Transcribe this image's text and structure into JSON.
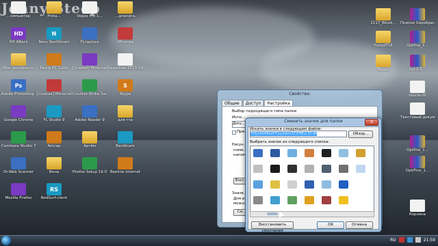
{
  "watermark": "Jonny Steep",
  "colors": {
    "folder": "#e5b53e",
    "taskbar": "#2a3543",
    "dialog_frame": "#a9c8e3"
  },
  "desktop_icons": [
    {
      "label": "...омпьютер",
      "glyph": "",
      "kind": "doc"
    },
    {
      "label": "Prota...",
      "glyph": "",
      "kind": "folder"
    },
    {
      "label": "Vegas Pro 1...",
      "glyph": "",
      "kind": "doc"
    },
    {
      "label": "...дписисъ",
      "glyph": "",
      "kind": "folder"
    },
    {
      "label": "HD ABeck",
      "glyph": "HD",
      "kind": "app"
    },
    {
      "label": "Nero StartSmart",
      "glyph": "N",
      "kind": "app"
    },
    {
      "label": "FLcapture",
      "glyph": "",
      "kind": "app"
    },
    {
      "label": "Облачка",
      "glyph": "",
      "kind": "app"
    },
    {
      "label": "Мои документы",
      "glyph": "",
      "kind": "folder"
    },
    {
      "label": "Nokia PC Suite",
      "glyph": "",
      "kind": "app"
    },
    {
      "label": "[Graded] Minecraft",
      "glyph": "",
      "kind": "app"
    },
    {
      "label": "bayarinet 2010-04-2...",
      "glyph": "",
      "kind": "doc"
    },
    {
      "label": "Adobe Photoshop CS5",
      "glyph": "Ps",
      "kind": "app"
    },
    {
      "label": "[License] Minecraft",
      "glyph": "",
      "kind": "app"
    },
    {
      "label": "Counter-Strike Source",
      "glyph": "",
      "kind": "app"
    },
    {
      "label": "Skype",
      "glyph": "S",
      "kind": "app"
    },
    {
      "label": "Google Chrome",
      "glyph": "",
      "kind": "app"
    },
    {
      "label": "FL Studio 9",
      "glyph": "",
      "kind": "app"
    },
    {
      "label": "Adobe Reader 9",
      "glyph": "",
      "kind": "app"
    },
    {
      "label": "для гта",
      "glyph": "",
      "kind": "folder"
    },
    {
      "label": "Camtasia Studio 7",
      "glyph": "",
      "kind": "app"
    },
    {
      "label": "Amcap",
      "glyph": "",
      "kind": "app"
    },
    {
      "label": "Артём",
      "glyph": "",
      "kind": "folder"
    },
    {
      "label": "Bandicam",
      "glyph": "",
      "kind": "app"
    },
    {
      "label": "Dr.Web Scanner",
      "glyph": "",
      "kind": "app"
    },
    {
      "label": "Инна",
      "glyph": "",
      "kind": "folder"
    },
    {
      "label": "Firefox Setup 19.0.2",
      "glyph": "",
      "kind": "app"
    },
    {
      "label": "Beeline Internet",
      "glyph": "",
      "kind": "app"
    },
    {
      "label": "Mozilla Firefox",
      "glyph": "",
      "kind": "app"
    },
    {
      "label": "RedSurf-client",
      "glyph": "RS",
      "kind": "app"
    }
  ],
  "right_icons": [
    {
      "label": "1117_Blood...",
      "kind": "folder"
    },
    {
      "label": "Поиски Хиробрин...",
      "kind": "rar"
    },
    {
      "label": "PumpIT18",
      "kind": "folder"
    },
    {
      "label": "Optfine_1...",
      "kind": "rar"
    },
    {
      "label": "Видео",
      "kind": "folder"
    },
    {
      "label": "rus-1-5...",
      "kind": "rar"
    },
    {
      "label": "iniuria.dll",
      "kind": "doc"
    },
    {
      "label": "Текстовый документ",
      "kind": "doc"
    },
    {
      "label": "Optfine_1...",
      "kind": "rar"
    },
    {
      "label": "OptiFine_1...",
      "kind": "rar"
    },
    {
      "label": "Корзина",
      "kind": "doc"
    }
  ],
  "props_dialog": {
    "title": "Свойства:",
    "tabs": [
      "Общие",
      "Доступ",
      "Настройка"
    ],
    "section": "Выбор подходящего типа папки",
    "use_label": "Испо...",
    "combo": "Доку...",
    "check_label": "При...",
    "pics_label": "Рисун...",
    "pics_text": [
      "поме...",
      "напом..."
    ],
    "restore": "Восс...",
    "icons_section": "Значк...",
    "icons_text": [
      "Для в...",
      "можн..."
    ],
    "change": "См..."
  },
  "icon_dialog": {
    "title": "Сменить значок для папки",
    "close": "X",
    "search_label": "Искать значки в следующем файле:",
    "path_value": "%SystemRoot%\\system32\\SHELL32.dll",
    "browse": "Обзор...",
    "select_label": "Выбрать значок из следующего списка:",
    "restore_default": "Восстановить умолчания",
    "ok": "OK",
    "cancel": "Отмена"
  },
  "tray": {
    "lang": "RU",
    "time": "21:59"
  }
}
